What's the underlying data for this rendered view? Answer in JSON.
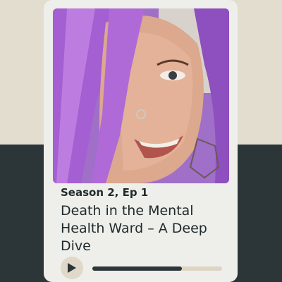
{
  "episode": {
    "label": "Season 2, Ep 1",
    "title": "Death in the Mental Health Ward – A Deep Dive"
  },
  "player": {
    "play_icon": "play-icon",
    "progress_fraction": 0.69
  },
  "colors": {
    "background_top": "#e3ddd0",
    "background_bottom": "#2c3537",
    "card": "#eeeeea",
    "accent": "#e0d8c8",
    "text": "#1f2a2c"
  }
}
